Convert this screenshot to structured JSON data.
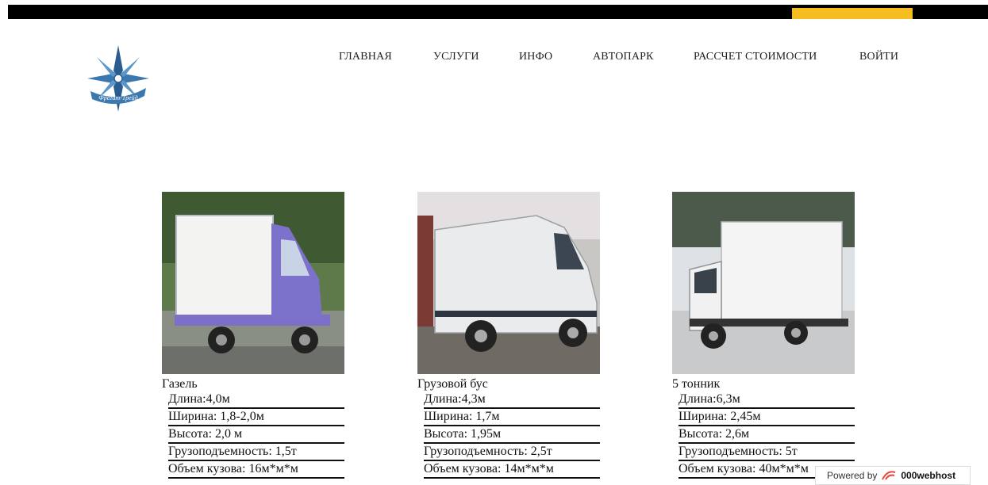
{
  "header": {
    "nav": [
      {
        "label": "ГЛАВНАЯ"
      },
      {
        "label": "УСЛУГИ"
      },
      {
        "label": "ИНФО"
      },
      {
        "label": "АВТОПАРК"
      },
      {
        "label": "РАССЧЕТ СТОИМОСТИ"
      },
      {
        "label": "ВОЙТИ"
      }
    ],
    "logo_text": "Фрегат-Трейд"
  },
  "colors": {
    "topbar": "#000000",
    "accent": "#f5bd1f"
  },
  "vehicles": [
    {
      "name": "Газель",
      "specs": [
        "Длина:4,0м",
        "Ширина: 1,8-2,0м",
        "Высота: 2,0 м",
        "Грузоподъемность: 1,5т",
        "Объем кузова: 16м*м*м"
      ]
    },
    {
      "name": "Грузовой бус",
      "specs": [
        "Длина:4,3м",
        "Ширина: 1,7м",
        "Высота: 1,95м",
        "Грузоподъемность: 2,5т",
        "Объем кузова: 14м*м*м"
      ]
    },
    {
      "name": "5 тонник",
      "specs": [
        "Длина:6,3м",
        "Ширина: 2,45м",
        "Высота: 2,6м",
        "Грузоподъемность: 5т",
        "Объем кузова: 40м*м*м"
      ]
    }
  ],
  "footer_badge": {
    "prefix": "Powered by",
    "brand": "000webhost"
  }
}
